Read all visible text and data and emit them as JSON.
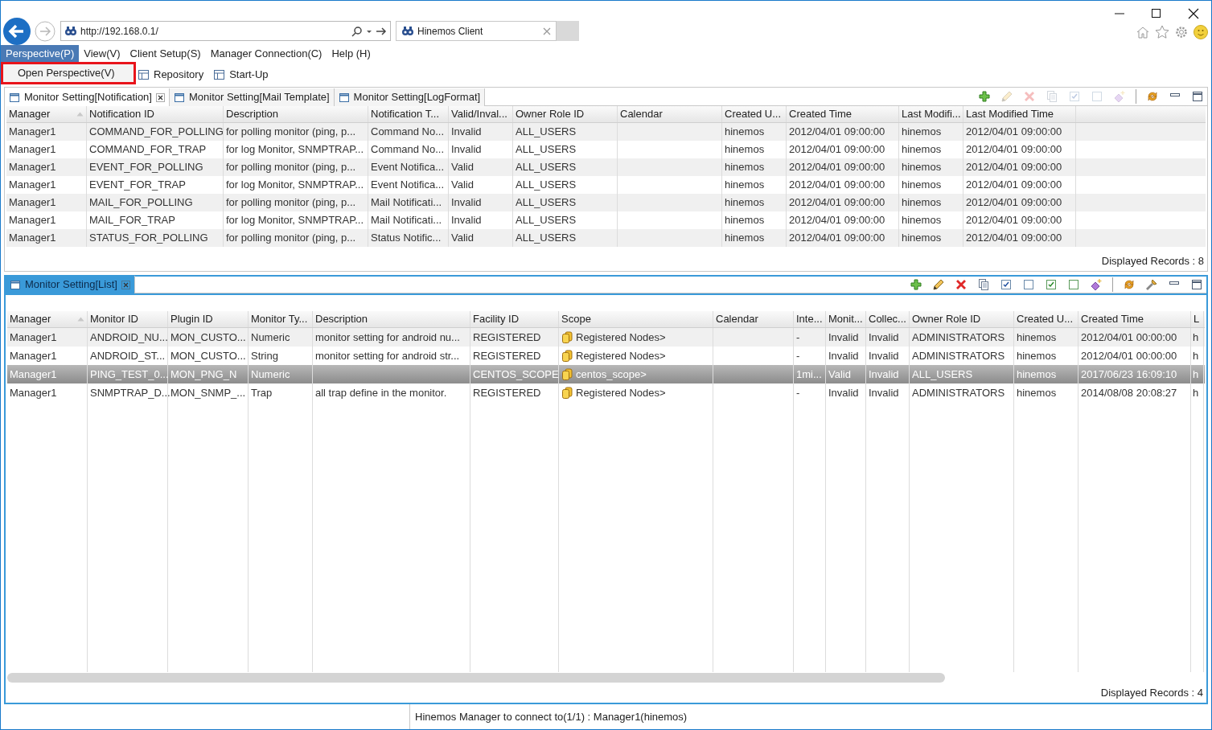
{
  "browser": {
    "url": "http://192.168.0.1/",
    "tab_title": "Hinemos Client"
  },
  "menu": [
    {
      "label": "Perspective(P)",
      "selected": true
    },
    {
      "label": "View(V)",
      "selected": false
    },
    {
      "label": "Client Setup(S)",
      "selected": false
    },
    {
      "label": "Manager Connection(C)",
      "selected": false
    },
    {
      "label": "Help (H)",
      "selected": false
    }
  ],
  "dropdown": {
    "items": [
      {
        "label": "Open Perspective(V)",
        "highlighted": true
      }
    ]
  },
  "perspectives": [
    {
      "label": "Repository"
    },
    {
      "label": "Start-Up"
    }
  ],
  "views": [
    {
      "active": false,
      "tabs": [
        {
          "label": "Monitor Setting[Notification]",
          "selected": true
        },
        {
          "label": "Monitor Setting[Mail Template]",
          "selected": false
        },
        {
          "label": "Monitor Setting[LogFormat]",
          "selected": false
        }
      ],
      "toolbar": [
        {
          "kind": "add",
          "disabled": false
        },
        {
          "kind": "edit",
          "disabled": true
        },
        {
          "kind": "delete",
          "disabled": true
        },
        {
          "kind": "copy",
          "disabled": true
        },
        {
          "kind": "check",
          "disabled": true
        },
        {
          "kind": "uncheck",
          "disabled": true
        },
        {
          "kind": "clear",
          "disabled": true
        },
        {
          "kind": "separator"
        },
        {
          "kind": "refresh",
          "disabled": false
        },
        {
          "kind": "minimize",
          "disabled": false
        },
        {
          "kind": "maximize",
          "disabled": false
        }
      ],
      "table": {
        "columns": [
          {
            "label": "Manager",
            "sorted": true,
            "kind": "text"
          },
          {
            "label": "Notification ID",
            "sorted": false,
            "kind": "text"
          },
          {
            "label": "Description",
            "sorted": false,
            "kind": "text"
          },
          {
            "label": "Notification T...",
            "sorted": false,
            "kind": "text"
          },
          {
            "label": "Valid/Inval...",
            "sorted": false,
            "kind": "text"
          },
          {
            "label": "Owner Role ID",
            "sorted": false,
            "kind": "text"
          },
          {
            "label": "Calendar",
            "sorted": false,
            "kind": "text"
          },
          {
            "label": "Created U...",
            "sorted": false,
            "kind": "text"
          },
          {
            "label": "Created Time",
            "sorted": false,
            "kind": "text"
          },
          {
            "label": "Last Modifi...",
            "sorted": false,
            "kind": "text"
          },
          {
            "label": "Last Modified Time",
            "sorted": false,
            "kind": "text"
          }
        ],
        "rows": [
          {
            "selected": false,
            "cells": [
              "Manager1",
              "COMMAND_FOR_POLLING",
              "for polling monitor (ping, p...",
              "Command No...",
              "Invalid",
              "ALL_USERS",
              "",
              "hinemos",
              "2012/04/01 09:00:00",
              "hinemos",
              "2012/04/01 09:00:00"
            ]
          },
          {
            "selected": false,
            "cells": [
              "Manager1",
              "COMMAND_FOR_TRAP",
              "for log Monitor, SNMPTRAP...",
              "Command No...",
              "Invalid",
              "ALL_USERS",
              "",
              "hinemos",
              "2012/04/01 09:00:00",
              "hinemos",
              "2012/04/01 09:00:00"
            ]
          },
          {
            "selected": false,
            "cells": [
              "Manager1",
              "EVENT_FOR_POLLING",
              "for polling monitor (ping, p...",
              "Event Notifica...",
              "Valid",
              "ALL_USERS",
              "",
              "hinemos",
              "2012/04/01 09:00:00",
              "hinemos",
              "2012/04/01 09:00:00"
            ]
          },
          {
            "selected": false,
            "cells": [
              "Manager1",
              "EVENT_FOR_TRAP",
              "for log Monitor, SNMPTRAP...",
              "Event Notifica...",
              "Valid",
              "ALL_USERS",
              "",
              "hinemos",
              "2012/04/01 09:00:00",
              "hinemos",
              "2012/04/01 09:00:00"
            ]
          },
          {
            "selected": false,
            "cells": [
              "Manager1",
              "MAIL_FOR_POLLING",
              "for polling monitor (ping, p...",
              "Mail Notificati...",
              "Invalid",
              "ALL_USERS",
              "",
              "hinemos",
              "2012/04/01 09:00:00",
              "hinemos",
              "2012/04/01 09:00:00"
            ]
          },
          {
            "selected": false,
            "cells": [
              "Manager1",
              "MAIL_FOR_TRAP",
              "for log Monitor, SNMPTRAP...",
              "Mail Notificati...",
              "Invalid",
              "ALL_USERS",
              "",
              "hinemos",
              "2012/04/01 09:00:00",
              "hinemos",
              "2012/04/01 09:00:00"
            ]
          },
          {
            "selected": false,
            "cells": [
              "Manager1",
              "STATUS_FOR_POLLING",
              "for polling monitor (ping, p...",
              "Status Notific...",
              "Valid",
              "ALL_USERS",
              "",
              "hinemos",
              "2012/04/01 09:00:00",
              "hinemos",
              "2012/04/01 09:00:00"
            ]
          }
        ]
      },
      "footer": "Displayed Records : 8"
    },
    {
      "active": true,
      "tabs": [
        {
          "label": "Monitor Setting[List]",
          "selected": true
        }
      ],
      "toolbar": [
        {
          "kind": "add",
          "disabled": false
        },
        {
          "kind": "edit",
          "disabled": false
        },
        {
          "kind": "delete",
          "disabled": false
        },
        {
          "kind": "copy",
          "disabled": false
        },
        {
          "kind": "check",
          "disabled": false
        },
        {
          "kind": "uncheck",
          "disabled": false
        },
        {
          "kind": "enable",
          "disabled": false
        },
        {
          "kind": "disable",
          "disabled": false
        },
        {
          "kind": "clear",
          "disabled": false
        },
        {
          "kind": "separator"
        },
        {
          "kind": "refresh",
          "disabled": false
        },
        {
          "kind": "brush",
          "disabled": false
        },
        {
          "kind": "minimize",
          "disabled": false
        },
        {
          "kind": "maximize",
          "disabled": false
        }
      ],
      "table": {
        "columns": [
          {
            "label": "Manager",
            "sorted": true,
            "kind": "text"
          },
          {
            "label": "Monitor ID",
            "sorted": false,
            "kind": "text"
          },
          {
            "label": "Plugin ID",
            "sorted": false,
            "kind": "text"
          },
          {
            "label": "Monitor Ty...",
            "sorted": false,
            "kind": "text"
          },
          {
            "label": "Description",
            "sorted": false,
            "kind": "text"
          },
          {
            "label": "Facility ID",
            "sorted": false,
            "kind": "text"
          },
          {
            "label": "Scope",
            "sorted": false,
            "kind": "scope"
          },
          {
            "label": "Calendar",
            "sorted": false,
            "kind": "text"
          },
          {
            "label": "Inte...",
            "sorted": false,
            "kind": "text"
          },
          {
            "label": "Monit...",
            "sorted": false,
            "kind": "text"
          },
          {
            "label": "Collec...",
            "sorted": false,
            "kind": "text"
          },
          {
            "label": "Owner Role ID",
            "sorted": false,
            "kind": "text"
          },
          {
            "label": "Created U...",
            "sorted": false,
            "kind": "text"
          },
          {
            "label": "Created Time",
            "sorted": false,
            "kind": "text"
          },
          {
            "label": "L",
            "sorted": false,
            "kind": "text"
          }
        ],
        "rows": [
          {
            "selected": false,
            "cells": [
              "Manager1",
              "ANDROID_NU...",
              "MON_CUSTO...",
              "Numeric",
              "monitor setting for android nu...",
              "REGISTERED",
              "Registered Nodes>",
              "",
              "-",
              "Invalid",
              "Invalid",
              "ADMINISTRATORS",
              "hinemos",
              "2012/04/01 00:00:00",
              "h"
            ]
          },
          {
            "selected": false,
            "cells": [
              "Manager1",
              "ANDROID_ST...",
              "MON_CUSTO...",
              "String",
              "monitor setting for android str...",
              "REGISTERED",
              "Registered Nodes>",
              "",
              "-",
              "Invalid",
              "Invalid",
              "ADMINISTRATORS",
              "hinemos",
              "2012/04/01 00:00:00",
              "h"
            ]
          },
          {
            "selected": true,
            "cells": [
              "Manager1",
              "PING_TEST_0...",
              "MON_PNG_N",
              "Numeric",
              "",
              "CENTOS_SCOPE",
              "centos_scope>",
              "",
              "1mi...",
              "Valid",
              "Invalid",
              "ALL_USERS",
              "hinemos",
              "2017/06/23 16:09:10",
              "h"
            ]
          },
          {
            "selected": false,
            "cells": [
              "Manager1",
              "SNMPTRAP_D...",
              "MON_SNMP_...",
              "Trap",
              "all trap define in the monitor.",
              "REGISTERED",
              "Registered Nodes>",
              "",
              "-",
              "Invalid",
              "Invalid",
              "ADMINISTRATORS",
              "hinemos",
              "2014/08/08 20:08:27",
              "h"
            ]
          }
        ]
      },
      "footer": "Displayed Records : 4"
    }
  ],
  "status_bar": "Hinemos Manager to connect to(1/1) : Manager1(hinemos)"
}
